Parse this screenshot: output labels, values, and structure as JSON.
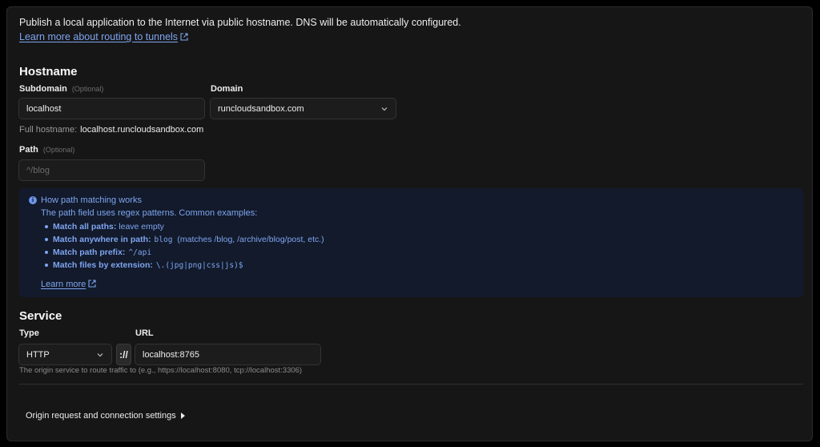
{
  "intro": {
    "text": "Publish a local application to the Internet via public hostname. DNS will be automatically configured.",
    "learn_link": "Learn more about routing to tunnels"
  },
  "hostname": {
    "heading": "Hostname",
    "subdomain_label": "Subdomain",
    "subdomain_optional": "(Optional)",
    "subdomain_value": "localhost",
    "domain_label": "Domain",
    "domain_value": "runcloudsandbox.com",
    "full_label": "Full hostname:",
    "full_value": "localhost.runcloudsandbox.com",
    "path_label": "Path",
    "path_optional": "(Optional)",
    "path_placeholder": "^/blog"
  },
  "info": {
    "title": "How path matching works",
    "subtitle": "The path field uses regex patterns. Common examples:",
    "items": [
      {
        "label": "Match all paths:",
        "code": "",
        "text": "leave empty"
      },
      {
        "label": "Match anywhere in path:",
        "code": "blog",
        "text": "(matches /blog, /archive/blog/post, etc.)"
      },
      {
        "label": "Match path prefix:",
        "code": "^/api",
        "text": ""
      },
      {
        "label": "Match files by extension:",
        "code": "\\.(jpg|png|css|js)$",
        "text": ""
      }
    ],
    "learn_more": "Learn more"
  },
  "service": {
    "heading": "Service",
    "type_label": "Type",
    "type_value": "HTTP",
    "scheme_sep": "://",
    "url_label": "URL",
    "url_value": "localhost:8765",
    "hint": "The origin service to route traffic to (e.g., https://localhost:8080, tcp://localhost:3306)"
  },
  "origin_settings": {
    "label": "Origin request and connection settings"
  },
  "icons": {
    "external": "external-link-icon",
    "chevron": "chevron-down-icon",
    "info": "info-icon",
    "expand": "caret-right-icon"
  },
  "colors": {
    "background": "#161616",
    "link": "#7fa5f0",
    "info_bg": "#121a2b"
  }
}
